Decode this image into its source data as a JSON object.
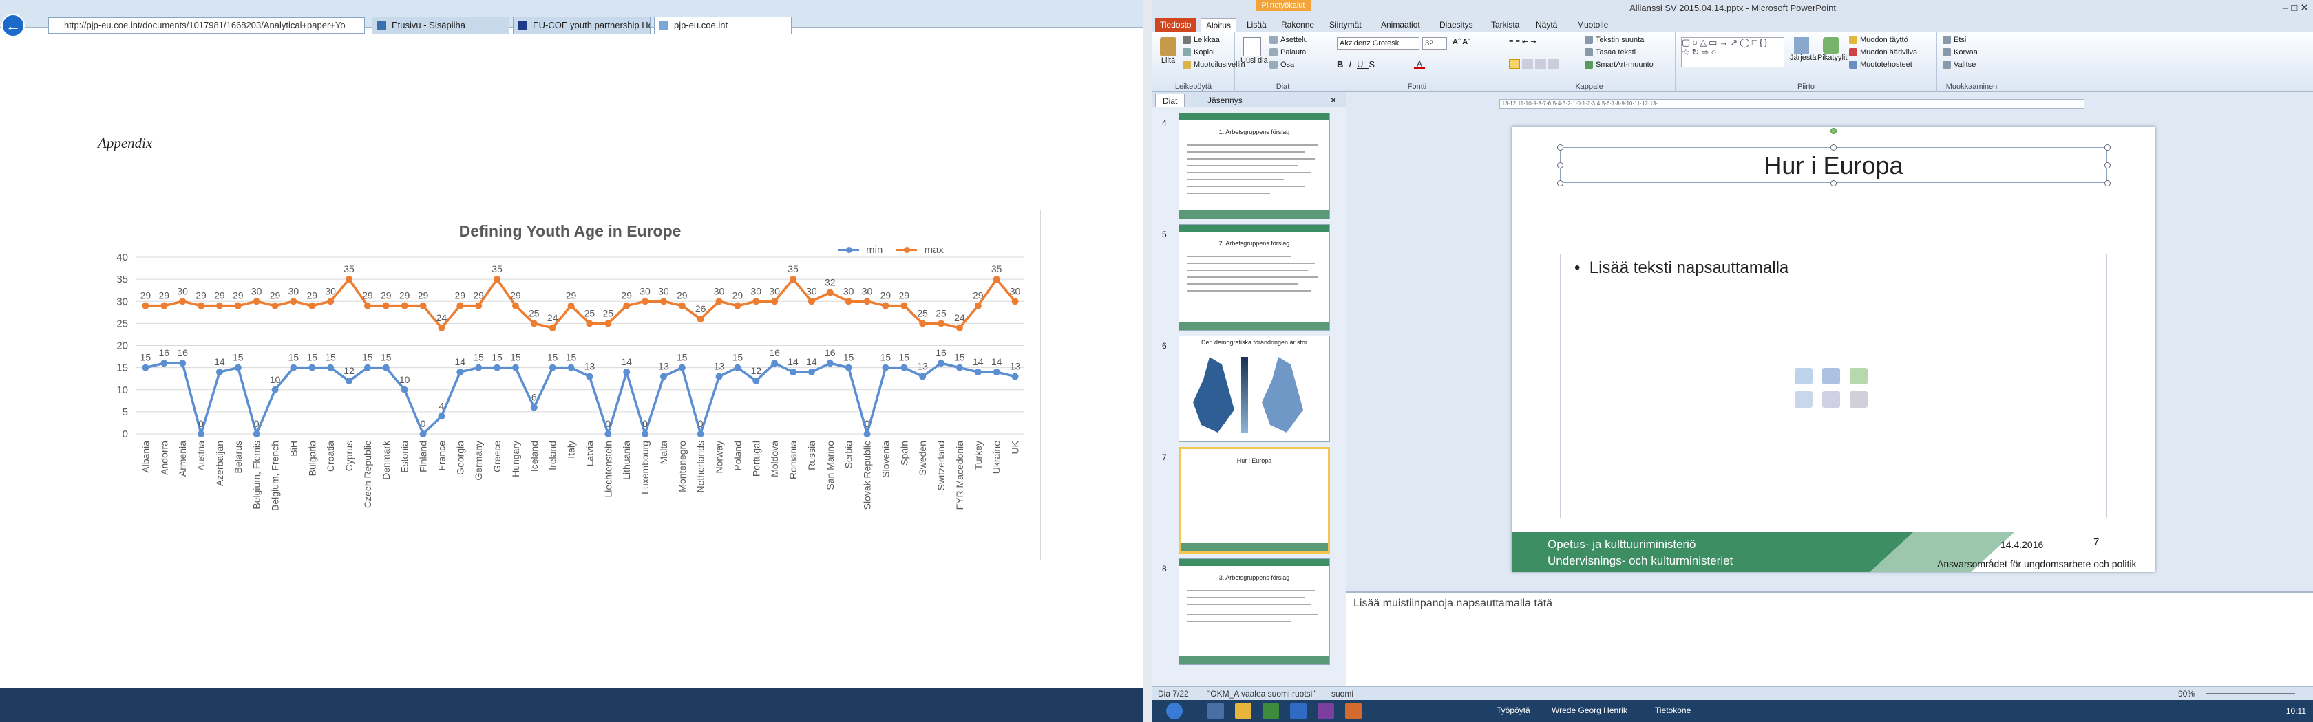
{
  "browser": {
    "address": "http://pjp-eu.coe.int/documents/1017981/1668203/Analytical+paper+Yo",
    "tabs": [
      {
        "label": "Etusivu - Sisäpiiha"
      },
      {
        "label": "EU-COE youth partnership Ho..."
      },
      {
        "label": "pjp-eu.coe.int"
      }
    ]
  },
  "document": {
    "heading": "Appendix"
  },
  "colors": {
    "min": "#5b8fd1",
    "max": "#ed7d31",
    "grid": "#d9d9d9",
    "axis_text": "#595959"
  },
  "chart_data": {
    "type": "line",
    "title": "Defining Youth Age in Europe",
    "ylim": [
      0,
      40
    ],
    "yticks": [
      0,
      5,
      10,
      15,
      20,
      25,
      30,
      35,
      40
    ],
    "grid": true,
    "legend_position": "top-right",
    "categories": [
      "Albania",
      "Andorra",
      "Armenia",
      "Austria",
      "Azerbaijan",
      "Belarus",
      "Belgium, Flemis",
      "Belgium, French",
      "BiH",
      "Bulgaria",
      "Croatia",
      "Cyprus",
      "Czech Republic",
      "Denmark",
      "Estonia",
      "Finland",
      "France",
      "Georgia",
      "Germany",
      "Greece",
      "Hungary",
      "Iceland",
      "Ireland",
      "Italy",
      "Latvia",
      "Liechtenstein",
      "Lithuania",
      "Luxembourg",
      "Malta",
      "Montenegro",
      "Netherlands",
      "Norway",
      "Poland",
      "Portugal",
      "Moldova",
      "Romania",
      "Russia",
      "San Marino",
      "Serbia",
      "Slovak Republic",
      "Slovenia",
      "Spain",
      "Sweden",
      "Switzerland",
      "FYR Macedonia",
      "Turkey",
      "Ukraine",
      "UK"
    ],
    "series": [
      {
        "name": "min",
        "values": [
          15,
          16,
          16,
          0,
          14,
          15,
          0,
          10,
          15,
          15,
          15,
          12,
          15,
          15,
          10,
          0,
          4,
          14,
          15,
          15,
          15,
          6,
          15,
          15,
          13,
          0,
          14,
          0,
          13,
          15,
          0,
          13,
          15,
          12,
          16,
          14,
          14,
          16,
          15,
          0,
          15,
          15,
          13,
          16,
          15,
          14,
          14,
          13
        ]
      },
      {
        "name": "max",
        "values": [
          29,
          29,
          30,
          29,
          29,
          29,
          30,
          29,
          30,
          29,
          30,
          35,
          29,
          29,
          29,
          29,
          24,
          29,
          29,
          35,
          29,
          25,
          24,
          29,
          25,
          25,
          29,
          30,
          30,
          29,
          26,
          30,
          29,
          30,
          30,
          35,
          30,
          32,
          30,
          30,
          29,
          29,
          25,
          25,
          24,
          29,
          35,
          30
        ]
      }
    ]
  },
  "ppt": {
    "title": "Allianssi SV 2015.04.14.pptx - Microsoft PowerPoint",
    "context_tab": "Piirtotyökalut",
    "ribbon_tabs": [
      "Tiedosto",
      "Aloitus",
      "Lisää",
      "Rakenne",
      "Siirtymät",
      "Animaatiot",
      "Diaesitys",
      "Tarkista",
      "Näytä",
      "Muotoile"
    ],
    "groups": [
      "Leikepöytä",
      "Diat",
      "Fontti",
      "Kappale",
      "Piirto",
      "Muokkaaminen"
    ],
    "clipboard": {
      "paste": "Liitä",
      "cut": "Leikkaa",
      "copy": "Kopioi",
      "format": "Muotoilusivellin"
    },
    "slides_group": {
      "new": "Uusi dia",
      "layout": "Asettelu",
      "reset": "Palauta",
      "section": "Osa"
    },
    "font": {
      "name": "Akzidenz Grotesk",
      "size": "32"
    },
    "paragraph": {
      "direction": "Tekstin suunta",
      "align": "Tasaa teksti",
      "smartart": "SmartArt-muunto"
    },
    "drawing": {
      "arrange": "Järjestä",
      "quick_styles": "Pikatyylit",
      "fill": "Muodon täyttö",
      "outline": "Muodon ääriviiva",
      "effects": "Muototehosteet"
    },
    "editing": {
      "find": "Etsi",
      "replace": "Korvaa",
      "select": "Valitse"
    },
    "panel_tabs": [
      "Diat",
      "Jäsennys"
    ],
    "thumbnails": [
      {
        "num": "4",
        "title": "1. Arbetsgruppens förslag"
      },
      {
        "num": "5",
        "title": "2. Arbetsgruppens förslag"
      },
      {
        "num": "6",
        "title": "Den demografiska förändringen är stor"
      },
      {
        "num": "7",
        "title": "Hur i Europa"
      },
      {
        "num": "8",
        "title": "3. Arbetsgruppens förslag"
      }
    ],
    "slide": {
      "title": "Hur i Europa",
      "bullet": "Lisää teksti napsauttamalla",
      "org_line1": "Opetus- ja kulttuuriministeriö",
      "org_line2": "Undervisnings- och kulturministeriet",
      "date": "14.4.2016",
      "number": "7",
      "department": "Ansvarsområdet för ungdomsarbete och politik"
    },
    "notes": "Lisää muistiinpanoja napsauttamalla tätä",
    "status": {
      "slide": "Dia 7/22",
      "theme": "\"OKM_A vaalea suomi ruotsi\"",
      "language": "suomi",
      "zoom": "90%"
    }
  },
  "taskbar": {
    "items": [
      "Työpöytä",
      "Wrede Georg Henrik",
      "Tietokone"
    ],
    "time": "10:11"
  }
}
